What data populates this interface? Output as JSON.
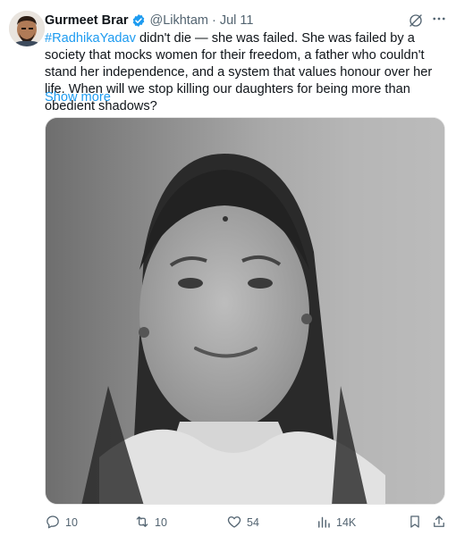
{
  "author": {
    "name": "Gurmeet Brar",
    "handle": "@Likhtam",
    "separator": "·",
    "date": "Jul 11"
  },
  "post": {
    "hashtag": "#RadhikaYadav",
    "body": " didn't die — she was failed. She was failed by a society that mocks women for their freedom, a father who couldn't stand her independence, and a system that values honour over her life. When will we stop killing our daughters for being more than obedient shadows?",
    "show_more": "Show more"
  },
  "icons": {
    "verified": "verified-badge-icon",
    "grok": "grok-icon",
    "more": "more-options-icon",
    "reply": "reply-icon",
    "repost": "repost-icon",
    "like": "like-icon",
    "views": "views-icon",
    "bookmark": "bookmark-icon",
    "share": "share-icon"
  },
  "media": {
    "description_kind": "black-and-white portrait photo"
  },
  "actions": {
    "replies": "10",
    "reposts": "10",
    "likes": "54",
    "views": "14K"
  },
  "colors": {
    "accent": "#1d9bf0",
    "muted": "#536471",
    "text": "#0f1419"
  }
}
